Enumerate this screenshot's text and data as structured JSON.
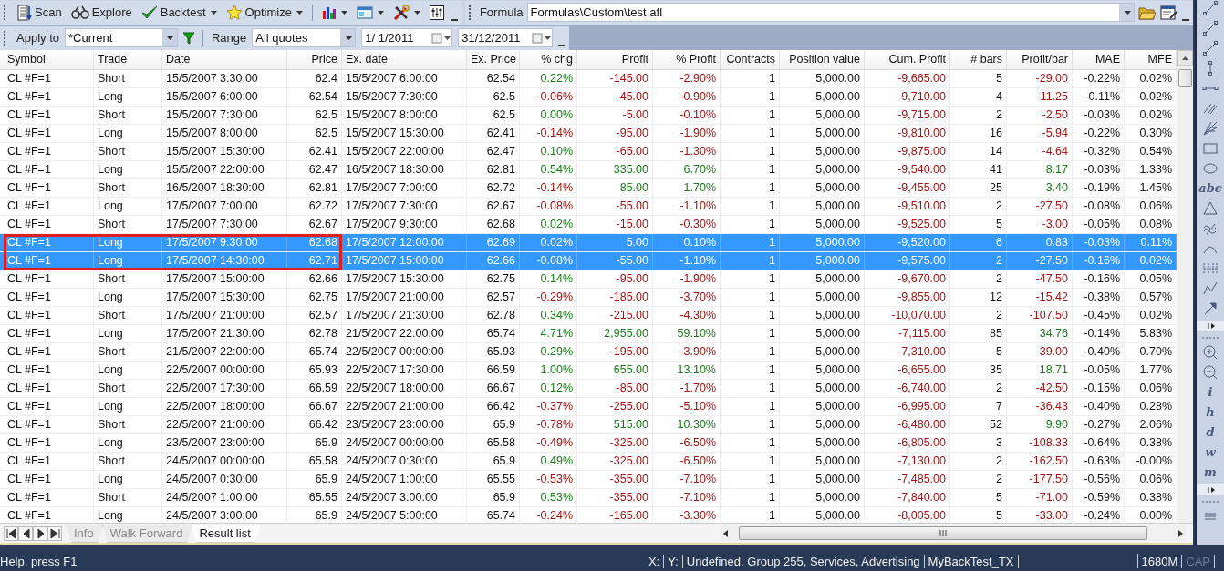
{
  "toolbar": {
    "buttons": [
      {
        "label": "Scan",
        "kind": "scan",
        "dropdown": false
      },
      {
        "label": "Explore",
        "kind": "explore",
        "dropdown": false
      },
      {
        "label": "Backtest",
        "kind": "backtest",
        "dropdown": true
      },
      {
        "label": "Optimize",
        "kind": "optimize",
        "dropdown": true
      }
    ],
    "tools": [
      {
        "kind": "chart",
        "dropdown": true
      },
      {
        "kind": "layout",
        "dropdown": true
      },
      {
        "kind": "tools",
        "dropdown": true
      },
      {
        "kind": "params",
        "dropdown": false
      }
    ],
    "formula": {
      "label": "Formula",
      "value": "Formulas\\Custom\\test.afl"
    }
  },
  "filter_bar": {
    "apply_label": "Apply to",
    "apply_value": "*Current",
    "range_label": "Range",
    "range_value": "All quotes",
    "from_date": "1/  1/2011",
    "to_date": "31/12/2011"
  },
  "table": {
    "columns": [
      {
        "label": "Symbol",
        "kind": "text"
      },
      {
        "label": "Trade",
        "kind": "text"
      },
      {
        "label": "Date",
        "kind": "text"
      },
      {
        "label": "Price",
        "kind": "number"
      },
      {
        "label": "Ex. date",
        "kind": "text"
      },
      {
        "label": "Ex. Price",
        "kind": "number"
      },
      {
        "label": "% chg",
        "kind": "signed"
      },
      {
        "label": "Profit",
        "kind": "signed"
      },
      {
        "label": "% Profit",
        "kind": "signed"
      },
      {
        "label": "Contracts",
        "kind": "number"
      },
      {
        "label": "Position value",
        "kind": "number"
      },
      {
        "label": "Cum. Profit",
        "kind": "signed"
      },
      {
        "label": "# bars",
        "kind": "number"
      },
      {
        "label": "Profit/bar",
        "kind": "signed"
      },
      {
        "label": "MAE",
        "kind": "number"
      },
      {
        "label": "MFE",
        "kind": "number"
      }
    ],
    "rows": [
      {
        "selected": false,
        "outlined": false,
        "cells": [
          "CL #F=1",
          "Short",
          "15/5/2007 3:30:00",
          "62.4",
          "15/5/2007 6:00:00",
          "62.54",
          "0.22%",
          "-145.00",
          "-2.90%",
          "1",
          "5,000.00",
          "-9,665.00",
          "5",
          "-29.00",
          "-0.22%",
          "0.02%"
        ]
      },
      {
        "selected": false,
        "outlined": false,
        "cells": [
          "CL #F=1",
          "Long",
          "15/5/2007 6:00:00",
          "62.54",
          "15/5/2007 7:30:00",
          "62.5",
          "-0.06%",
          "-45.00",
          "-0.90%",
          "1",
          "5,000.00",
          "-9,710.00",
          "4",
          "-11.25",
          "-0.11%",
          "0.02%"
        ]
      },
      {
        "selected": false,
        "outlined": false,
        "cells": [
          "CL #F=1",
          "Short",
          "15/5/2007 7:30:00",
          "62.5",
          "15/5/2007 8:00:00",
          "62.5",
          "0.00%",
          "-5.00",
          "-0.10%",
          "1",
          "5,000.00",
          "-9,715.00",
          "2",
          "-2.50",
          "-0.03%",
          "0.02%"
        ]
      },
      {
        "selected": false,
        "outlined": false,
        "cells": [
          "CL #F=1",
          "Long",
          "15/5/2007 8:00:00",
          "62.5",
          "15/5/2007 15:30:00",
          "62.41",
          "-0.14%",
          "-95.00",
          "-1.90%",
          "1",
          "5,000.00",
          "-9,810.00",
          "16",
          "-5.94",
          "-0.22%",
          "0.30%"
        ]
      },
      {
        "selected": false,
        "outlined": false,
        "cells": [
          "CL #F=1",
          "Short",
          "15/5/2007 15:30:00",
          "62.41",
          "15/5/2007 22:00:00",
          "62.47",
          "0.10%",
          "-65.00",
          "-1.30%",
          "1",
          "5,000.00",
          "-9,875.00",
          "14",
          "-4.64",
          "-0.32%",
          "0.54%"
        ]
      },
      {
        "selected": false,
        "outlined": false,
        "cells": [
          "CL #F=1",
          "Long",
          "15/5/2007 22:00:00",
          "62.47",
          "16/5/2007 18:30:00",
          "62.81",
          "0.54%",
          "335.00",
          "6.70%",
          "1",
          "5,000.00",
          "-9,540.00",
          "41",
          "8.17",
          "-0.03%",
          "1.33%"
        ]
      },
      {
        "selected": false,
        "outlined": false,
        "cells": [
          "CL #F=1",
          "Short",
          "16/5/2007 18:30:00",
          "62.81",
          "17/5/2007 7:00:00",
          "62.72",
          "-0.14%",
          "85.00",
          "1.70%",
          "1",
          "5,000.00",
          "-9,455.00",
          "25",
          "3.40",
          "-0.19%",
          "1.45%"
        ]
      },
      {
        "selected": false,
        "outlined": false,
        "cells": [
          "CL #F=1",
          "Long",
          "17/5/2007 7:00:00",
          "62.72",
          "17/5/2007 7:30:00",
          "62.67",
          "-0.08%",
          "-55.00",
          "-1.10%",
          "1",
          "5,000.00",
          "-9,510.00",
          "2",
          "-27.50",
          "-0.08%",
          "0.06%"
        ]
      },
      {
        "selected": false,
        "outlined": false,
        "cells": [
          "CL #F=1",
          "Short",
          "17/5/2007 7:30:00",
          "62.67",
          "17/5/2007 9:30:00",
          "62.68",
          "0.02%",
          "-15.00",
          "-0.30%",
          "1",
          "5,000.00",
          "-9,525.00",
          "5",
          "-3.00",
          "-0.05%",
          "0.08%"
        ]
      },
      {
        "selected": true,
        "outlined": true,
        "cells": [
          "CL #F=1",
          "Long",
          "17/5/2007 9:30:00",
          "62.68",
          "17/5/2007 12:00:00",
          "62.69",
          "0.02%",
          "5.00",
          "0.10%",
          "1",
          "5,000.00",
          "-9,520.00",
          "6",
          "0.83",
          "-0.03%",
          "0.11%"
        ]
      },
      {
        "selected": true,
        "outlined": true,
        "cells": [
          "CL #F=1",
          "Long",
          "17/5/2007 14:30:00",
          "62.71",
          "17/5/2007 15:00:00",
          "62.66",
          "-0.08%",
          "-55.00",
          "-1.10%",
          "1",
          "5,000.00",
          "-9,575.00",
          "2",
          "-27.50",
          "-0.16%",
          "0.02%"
        ]
      },
      {
        "selected": false,
        "outlined": false,
        "cells": [
          "CL #F=1",
          "Short",
          "17/5/2007 15:00:00",
          "62.66",
          "17/5/2007 15:30:00",
          "62.75",
          "0.14%",
          "-95.00",
          "-1.90%",
          "1",
          "5,000.00",
          "-9,670.00",
          "2",
          "-47.50",
          "-0.16%",
          "0.05%"
        ]
      },
      {
        "selected": false,
        "outlined": false,
        "cells": [
          "CL #F=1",
          "Long",
          "17/5/2007 15:30:00",
          "62.75",
          "17/5/2007 21:00:00",
          "62.57",
          "-0.29%",
          "-185.00",
          "-3.70%",
          "1",
          "5,000.00",
          "-9,855.00",
          "12",
          "-15.42",
          "-0.38%",
          "0.57%"
        ]
      },
      {
        "selected": false,
        "outlined": false,
        "cells": [
          "CL #F=1",
          "Short",
          "17/5/2007 21:00:00",
          "62.57",
          "17/5/2007 21:30:00",
          "62.78",
          "0.34%",
          "-215.00",
          "-4.30%",
          "1",
          "5,000.00",
          "-10,070.00",
          "2",
          "-107.50",
          "-0.45%",
          "0.02%"
        ]
      },
      {
        "selected": false,
        "outlined": false,
        "cells": [
          "CL #F=1",
          "Long",
          "17/5/2007 21:30:00",
          "62.78",
          "21/5/2007 22:00:00",
          "65.74",
          "4.71%",
          "2,955.00",
          "59.10%",
          "1",
          "5,000.00",
          "-7,115.00",
          "85",
          "34.76",
          "-0.14%",
          "5.83%"
        ]
      },
      {
        "selected": false,
        "outlined": false,
        "cells": [
          "CL #F=1",
          "Short",
          "21/5/2007 22:00:00",
          "65.74",
          "22/5/2007 00:00:00",
          "65.93",
          "0.29%",
          "-195.00",
          "-3.90%",
          "1",
          "5,000.00",
          "-7,310.00",
          "5",
          "-39.00",
          "-0.40%",
          "0.70%"
        ]
      },
      {
        "selected": false,
        "outlined": false,
        "cells": [
          "CL #F=1",
          "Long",
          "22/5/2007 00:00:00",
          "65.93",
          "22/5/2007 17:30:00",
          "66.59",
          "1.00%",
          "655.00",
          "13.10%",
          "1",
          "5,000.00",
          "-6,655.00",
          "35",
          "18.71",
          "-0.05%",
          "1.77%"
        ]
      },
      {
        "selected": false,
        "outlined": false,
        "cells": [
          "CL #F=1",
          "Short",
          "22/5/2007 17:30:00",
          "66.59",
          "22/5/2007 18:00:00",
          "66.67",
          "0.12%",
          "-85.00",
          "-1.70%",
          "1",
          "5,000.00",
          "-6,740.00",
          "2",
          "-42.50",
          "-0.15%",
          "0.06%"
        ]
      },
      {
        "selected": false,
        "outlined": false,
        "cells": [
          "CL #F=1",
          "Long",
          "22/5/2007 18:00:00",
          "66.67",
          "22/5/2007 21:00:00",
          "66.42",
          "-0.37%",
          "-255.00",
          "-5.10%",
          "1",
          "5,000.00",
          "-6,995.00",
          "7",
          "-36.43",
          "-0.40%",
          "0.28%"
        ]
      },
      {
        "selected": false,
        "outlined": false,
        "cells": [
          "CL #F=1",
          "Short",
          "22/5/2007 21:00:00",
          "66.42",
          "23/5/2007 23:00:00",
          "65.9",
          "-0.78%",
          "515.00",
          "10.30%",
          "1",
          "5,000.00",
          "-6,480.00",
          "52",
          "9.90",
          "-0.27%",
          "2.06%"
        ]
      },
      {
        "selected": false,
        "outlined": false,
        "cells": [
          "CL #F=1",
          "Long",
          "23/5/2007 23:00:00",
          "65.9",
          "24/5/2007 00:00:00",
          "65.58",
          "-0.49%",
          "-325.00",
          "-6.50%",
          "1",
          "5,000.00",
          "-6,805.00",
          "3",
          "-108.33",
          "-0.64%",
          "0.38%"
        ]
      },
      {
        "selected": false,
        "outlined": false,
        "cells": [
          "CL #F=1",
          "Short",
          "24/5/2007 00:00:00",
          "65.58",
          "24/5/2007 0:30:00",
          "65.9",
          "0.49%",
          "-325.00",
          "-6.50%",
          "1",
          "5,000.00",
          "-7,130.00",
          "2",
          "-162.50",
          "-0.63%",
          "-0.00%"
        ]
      },
      {
        "selected": false,
        "outlined": false,
        "cells": [
          "CL #F=1",
          "Long",
          "24/5/2007 0:30:00",
          "65.9",
          "24/5/2007 1:00:00",
          "65.55",
          "-0.53%",
          "-355.00",
          "-7.10%",
          "1",
          "5,000.00",
          "-7,485.00",
          "2",
          "-177.50",
          "-0.56%",
          "0.06%"
        ]
      },
      {
        "selected": false,
        "outlined": false,
        "cells": [
          "CL #F=1",
          "Short",
          "24/5/2007 1:00:00",
          "65.55",
          "24/5/2007 3:00:00",
          "65.9",
          "0.53%",
          "-355.00",
          "-7.10%",
          "1",
          "5,000.00",
          "-7,840.00",
          "5",
          "-71.00",
          "-0.59%",
          "0.38%"
        ]
      },
      {
        "selected": false,
        "outlined": false,
        "cells": [
          "CL #F=1",
          "Long",
          "24/5/2007 3:00:00",
          "65.9",
          "24/5/2007 5:00:00",
          "65.74",
          "-0.24%",
          "-165.00",
          "-3.30%",
          "1",
          "5,000.00",
          "-8,005.00",
          "5",
          "-33.00",
          "-0.24%",
          "0.00%"
        ]
      }
    ]
  },
  "sheet_tabs": [
    {
      "label": "Info",
      "selected": false
    },
    {
      "label": "Walk Forward",
      "selected": false
    },
    {
      "label": "Result list",
      "selected": true
    }
  ],
  "status_bar": {
    "help": "Help, press F1",
    "panes": [
      {
        "text": "X:",
        "disabled": false
      },
      {
        "text": "Y:",
        "disabled": false
      },
      {
        "text": "Undefined, Group 255, Services, Advertising",
        "disabled": false
      },
      {
        "text": "MyBackTest_TX",
        "disabled": false
      },
      {
        "text": "1680M",
        "disabled": false
      },
      {
        "text": "CAP",
        "disabled": true
      }
    ]
  },
  "drawing_toolbar": {
    "items": [
      {
        "kind": "segment"
      },
      {
        "kind": "segment"
      },
      {
        "kind": "segment"
      },
      {
        "kind": "vline"
      },
      {
        "kind": "hline"
      },
      {
        "kind": "parallel"
      },
      {
        "kind": "fan"
      },
      {
        "kind": "rect"
      },
      {
        "kind": "ellipse"
      },
      {
        "kind": "glyph",
        "label": "abc"
      },
      {
        "kind": "triangle"
      },
      {
        "kind": "wave"
      },
      {
        "kind": "arc"
      },
      {
        "kind": "cycles"
      },
      {
        "kind": "zigzag"
      },
      {
        "kind": "arrow"
      },
      {
        "kind": "more"
      },
      {
        "kind": "grip"
      },
      {
        "kind": "zoom-in"
      },
      {
        "kind": "zoom-out"
      },
      {
        "kind": "glyph",
        "label": "i"
      },
      {
        "kind": "glyph",
        "label": "h"
      },
      {
        "kind": "glyph",
        "label": "d"
      },
      {
        "kind": "glyph",
        "label": "w"
      },
      {
        "kind": "glyph",
        "label": "m"
      },
      {
        "kind": "more"
      },
      {
        "kind": "grip"
      },
      {
        "kind": "lines"
      }
    ]
  }
}
